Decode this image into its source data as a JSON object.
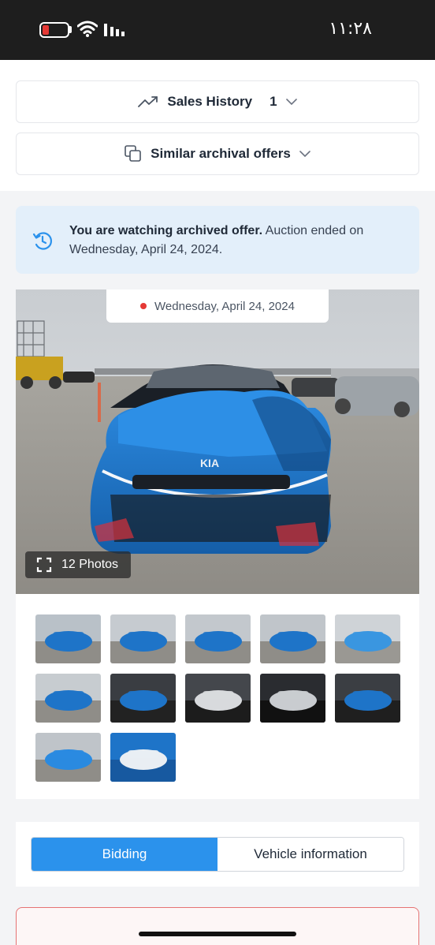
{
  "status_bar": {
    "time": "١١:٢٨",
    "battery_level": 0.15
  },
  "sales_history": {
    "label": "Sales History",
    "count": "1",
    "icon": "trend-up-icon"
  },
  "similar_offers": {
    "label": "Similar archival offers",
    "icon": "copy-icon"
  },
  "notice": {
    "bold": "You are watching archived offer.",
    "rest": " Auction ended on Wednesday, April 24, 2024.",
    "icon": "history-icon"
  },
  "gallery": {
    "date": "Wednesday, April 24, 2024",
    "photos_label": "12 Photos",
    "thumbnails": [
      "front-left-damage",
      "rear-left",
      "left-side",
      "front-left",
      "front-damage",
      "rear",
      "front-seats",
      "dashboard",
      "instrument-cluster",
      "rear-seats",
      "hood-damage",
      "window-sticker"
    ]
  },
  "tabs": [
    {
      "label": "Bidding",
      "active": true
    },
    {
      "label": "Vehicle information",
      "active": false
    }
  ],
  "colors": {
    "accent": "#2b92ec",
    "car_blue": "#1e74c8",
    "notice_bg": "#e3effa",
    "alert": "#e53935"
  }
}
